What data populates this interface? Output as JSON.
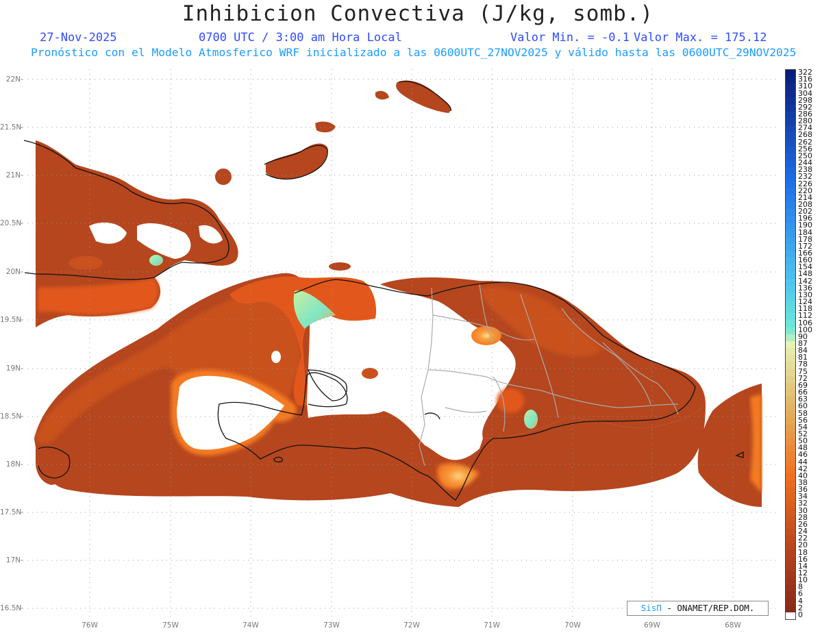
{
  "title": "Inhibicion Convectiva (J/kg, somb.)",
  "header": {
    "date": "27-Nov-2025",
    "time": "0700 UTC / 3:00 am Hora Local",
    "valor_min": "Valor Min. = -0.1",
    "valor_max": "Valor Max. = 175.12",
    "subtitle": "Pronóstico con el Modelo Atmosferico WRF inicializado a las 0600UTC_27NOV2025 y válido hasta las  0600UTC_29NOV2025"
  },
  "lat_labels": [
    "22N",
    "21.5N",
    "21N",
    "20.5N",
    "20N",
    "19.5N",
    "19N",
    "18.5N",
    "18N",
    "17.5N",
    "17N",
    "16.5N"
  ],
  "lon_labels": [
    "76W",
    "75W",
    "74W",
    "73W",
    "72W",
    "71W",
    "70W",
    "69W",
    "68W"
  ],
  "colorbar": {
    "labels": [
      "322",
      "316",
      "310",
      "304",
      "298",
      "292",
      "286",
      "280",
      "274",
      "268",
      "262",
      "256",
      "250",
      "244",
      "238",
      "232",
      "226",
      "220",
      "214",
      "208",
      "202",
      "196",
      "190",
      "184",
      "178",
      "172",
      "166",
      "160",
      "154",
      "148",
      "142",
      "136",
      "130",
      "124",
      "118",
      "112",
      "106",
      "100",
      "90",
      "87",
      "84",
      "81",
      "78",
      "75",
      "72",
      "69",
      "66",
      "63",
      "60",
      "58",
      "56",
      "54",
      "52",
      "50",
      "48",
      "46",
      "44",
      "42",
      "40",
      "38",
      "36",
      "34",
      "32",
      "30",
      "28",
      "26",
      "24",
      "22",
      "20",
      "18",
      "16",
      "14",
      "12",
      "10",
      "8",
      "6",
      "4",
      "2",
      "0"
    ],
    "colors": {
      "top": "#0b1d7a",
      "blue": "#1f6fe8",
      "light_blue": "#4cc3ef",
      "cyan": "#6de8d8",
      "pale_green": "#e4f2b4",
      "tan": "#e2b060",
      "orange": "#f07020",
      "brick": "#b5441e",
      "dark": "#8a2a1a",
      "zero": "#ffffff"
    }
  },
  "legend_colors": {
    "field_low": "#b03c16",
    "field_mid": "#e2581c",
    "field_orange": "#f47a22",
    "field_edge": "#f9a64a",
    "field_high": "#7fe6c4"
  },
  "credit": {
    "brand": "SisΠ",
    "text": " - ONAMET/REP.DOM."
  }
}
